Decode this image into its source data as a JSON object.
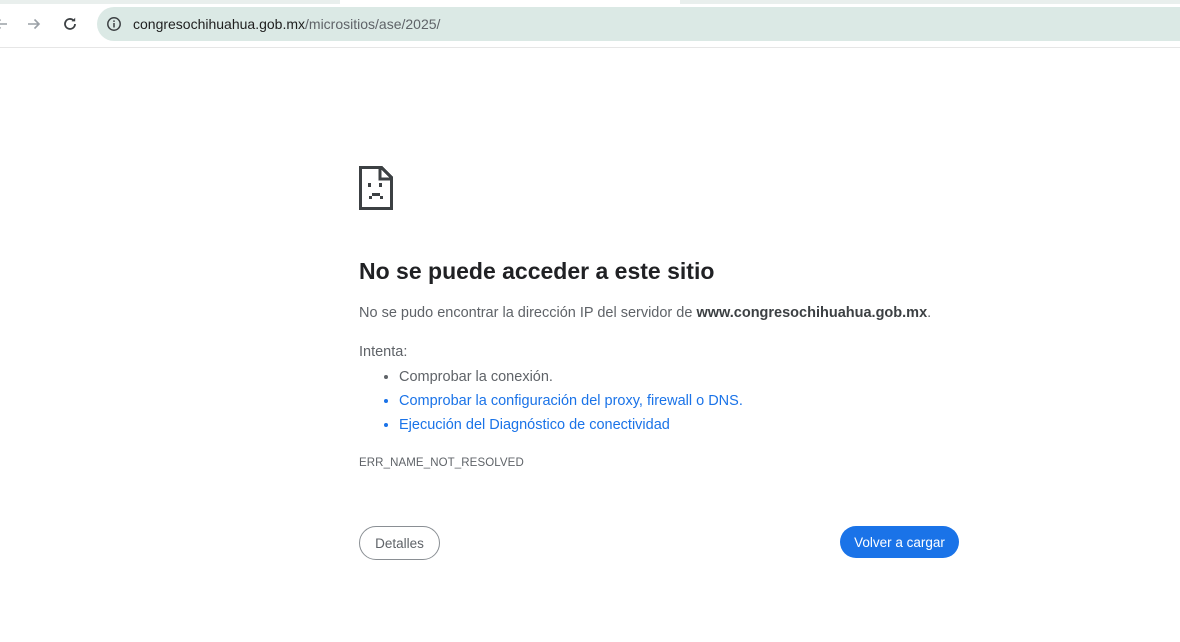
{
  "browser": {
    "url_host": "congresochihuahua.gob.mx",
    "url_path": "/micrositios/ase/2025/",
    "icons": {
      "back": "arrow-left-icon",
      "forward": "arrow-right-icon",
      "reload": "reload-icon",
      "site_info": "info-circle-icon"
    }
  },
  "error_page": {
    "icon": "sad-page-icon",
    "title": "No se puede acceder a este sitio",
    "description_prefix": "No se pudo encontrar la dirección IP del servidor de ",
    "description_host": "www.congresochihuahua.gob.mx",
    "description_suffix": ".",
    "try_label": "Intenta:",
    "suggestions": [
      {
        "label": "Comprobar la conexión.",
        "is_link": false
      },
      {
        "label": "Comprobar la configuración del proxy, firewall o DNS.",
        "is_link": true
      },
      {
        "label": "Ejecución del Diagnóstico de conectividad",
        "is_link": true
      }
    ],
    "error_code": "ERR_NAME_NOT_RESOLVED",
    "details_button": "Detalles",
    "reload_button": "Volver a cargar"
  },
  "colors": {
    "accent": "#1a73e8",
    "omnibox_bg": "#dbe9e5",
    "text_secondary": "#5f6368",
    "title_text": "#202124"
  }
}
